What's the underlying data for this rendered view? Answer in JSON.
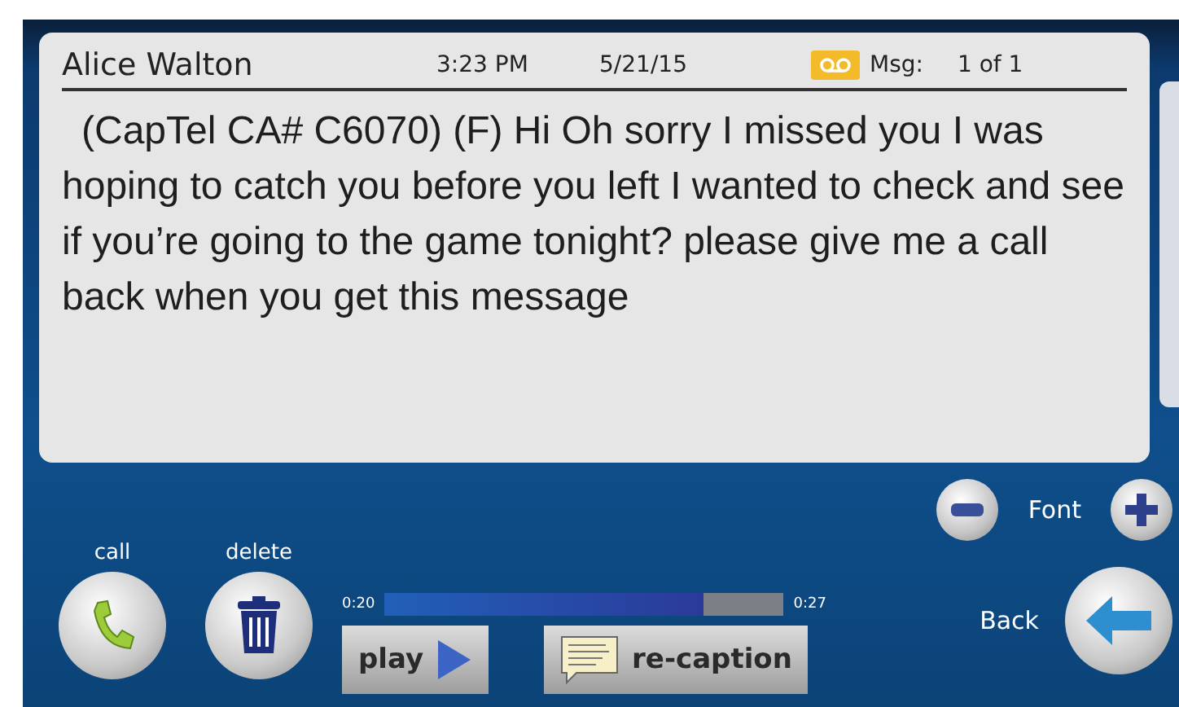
{
  "header": {
    "sender": "Alice Walton",
    "time": "3:23  PM",
    "date": "5/21/15",
    "msg_label": "Msg:",
    "msg_count": "1 of 1"
  },
  "message": "(CapTel CA# C6070) (F) Hi Oh sorry I missed you I was hoping to catch you before you left  I wanted to check and see if you’re going to the game tonight?   please give me a call back when you get this message",
  "font": {
    "label": "Font"
  },
  "actions": [
    {
      "label": "call",
      "kind": "call"
    },
    {
      "label": "delete",
      "kind": "delete"
    }
  ],
  "playback": {
    "start": "0:20",
    "end": "0:27",
    "level": 0.8
  },
  "buttons": [
    {
      "label": "play",
      "kind": "play"
    },
    {
      "label": "re-caption",
      "kind": "recaption"
    }
  ],
  "back": {
    "label": "Back"
  }
}
